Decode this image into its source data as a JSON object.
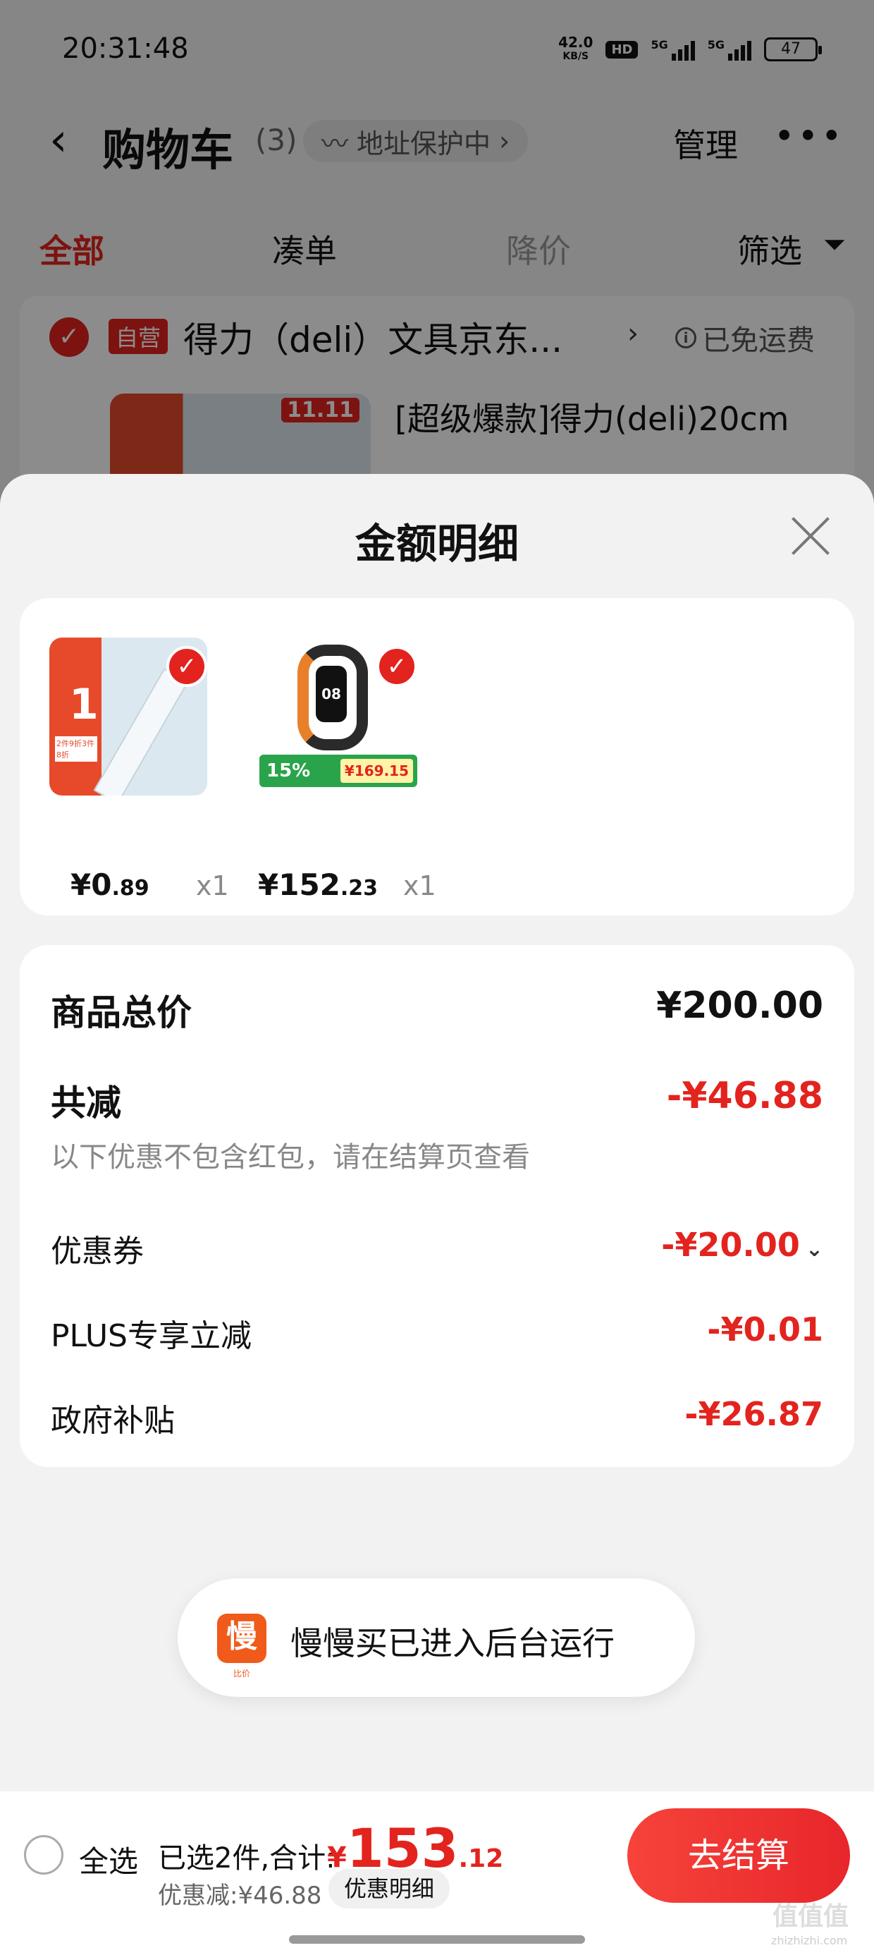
{
  "status_bar": {
    "time": "20:31:48",
    "net_speed_value": "42.0",
    "net_speed_unit": "KB/S",
    "hd": "HD",
    "sig1": "5G",
    "sig2": "5G",
    "battery": "47"
  },
  "nav": {
    "back_icon": "chevron-left-icon",
    "title": "购物车",
    "count": "(3)",
    "address": "地址保护中",
    "manage": "管理",
    "more": "•••"
  },
  "tabs": [
    {
      "label": "全部"
    },
    {
      "label": "凑单"
    },
    {
      "label": "降价"
    },
    {
      "label": "筛选"
    }
  ],
  "store": {
    "badge": "自营",
    "name": "得力（deli）文具京东...",
    "free_shipping": "已免运费",
    "thumb_badge": "11.11",
    "product_title": "[超级爆款]得力(deli)20cm"
  },
  "sheet": {
    "title": "金额明细"
  },
  "items": [
    {
      "price_int": "¥0",
      "price_dec": ".89",
      "qty": "x1",
      "img_big": "1",
      "img_label": "2件9折3件8折",
      "selected": true
    },
    {
      "price_int": "¥152",
      "price_dec": ".23",
      "qty": "x1",
      "img_screen": "08",
      "img_tag": "15%",
      "img_tag_price": "¥169.15",
      "selected": true
    }
  ],
  "summary": {
    "goods_total_label": "商品总价",
    "goods_total_value": "¥200.00",
    "discount_total_label": "共减",
    "discount_total_value": "-¥46.88",
    "note": "以下优惠不包含红包，请在结算页查看",
    "rows": [
      {
        "label": "优惠券",
        "value": "-¥20.00"
      },
      {
        "label": "PLUS专享立减",
        "value": "-¥0.01"
      },
      {
        "label": "政府补贴",
        "value": "-¥26.87"
      }
    ]
  },
  "toast": {
    "logo_char": "慢",
    "logo_sub": "比价",
    "text": "慢慢买已进入后台运行"
  },
  "bottom_bar": {
    "select_all": "全选",
    "selected_info": "已选2件,合计:",
    "total_currency": "¥",
    "total_int": "153",
    "total_dec": ".12",
    "discount_info": "优惠减:¥46.88",
    "discount_detail": "优惠明细",
    "checkout": "去结算"
  },
  "watermark": {
    "text": "值值值",
    "sub": "zhizhizhi.com"
  },
  "colors": {
    "accent": "#e3231e",
    "sheet_bg": "#f2f2f2",
    "card_bg": "#ffffff"
  }
}
